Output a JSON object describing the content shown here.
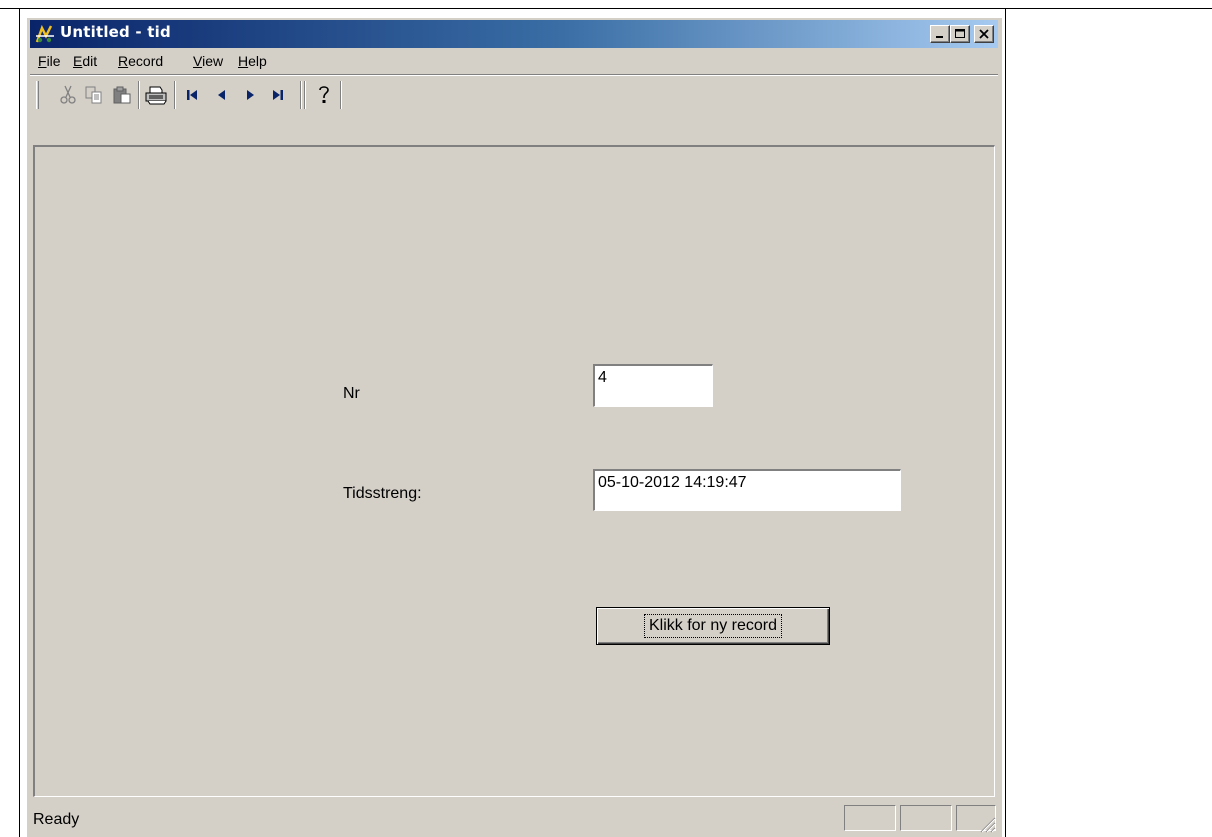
{
  "window": {
    "title": "Untitled - tid"
  },
  "titlebar_buttons": {
    "minimize": "_",
    "maximize": "□",
    "close": "✕"
  },
  "menu": {
    "file": {
      "accel": "F",
      "rest": "ile"
    },
    "edit": {
      "accel": "E",
      "rest": "dit"
    },
    "record": {
      "accel": "R",
      "rest": "ecord"
    },
    "view": {
      "accel": "V",
      "rest": "iew"
    },
    "help": {
      "accel": "H",
      "rest": "elp"
    }
  },
  "toolbar": {
    "icons": [
      "cut-icon",
      "copy-icon",
      "paste-icon",
      "print-icon",
      "first-record-icon",
      "previous-record-icon",
      "next-record-icon",
      "last-record-icon",
      "help-icon"
    ]
  },
  "form": {
    "nr_label": "Nr",
    "nr_value": "4",
    "tid_label": "Tidsstreng:",
    "tid_value": "05-10-2012 14:19:47",
    "new_record_button": "Klikk for ny record"
  },
  "status": {
    "text": "Ready"
  }
}
